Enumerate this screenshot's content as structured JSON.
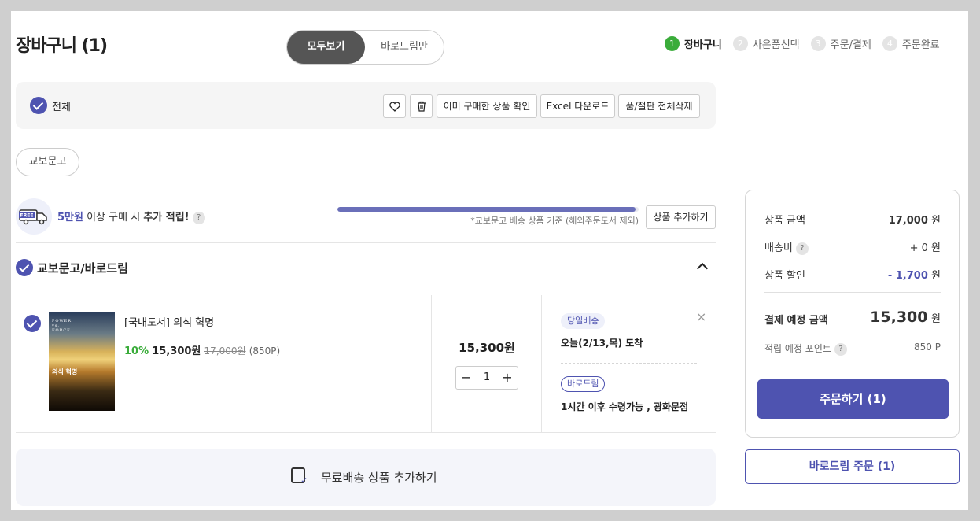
{
  "page": {
    "title": "장바구니 (1)"
  },
  "view_toggle": {
    "all": "모두보기",
    "barodrim_only": "바로드림만"
  },
  "steps": [
    {
      "num": "1",
      "label": "장바구니",
      "active": true
    },
    {
      "num": "2",
      "label": "사은품선택",
      "active": false
    },
    {
      "num": "3",
      "label": "주문/결제",
      "active": false
    },
    {
      "num": "4",
      "label": "주문완료",
      "active": false
    }
  ],
  "toolbar": {
    "select_all": "전체",
    "wish_icon": "heart-icon",
    "delete_icon": "trash-icon",
    "already_bought": "이미 구매한 상품 확인",
    "excel": "Excel 다운로드",
    "delete_soldout": "품/절판 전체삭제"
  },
  "filter_chip": "교보문고",
  "benefit": {
    "amount": "5만원",
    "text_mid": " 이상 구매 시 ",
    "text_bold": "추가 적립!",
    "help": "?",
    "note": "*교보문고 배송 상품 기준 (해외주문도서 제외)",
    "add_button": "상품 추가하기",
    "progress": 0.99,
    "truck_label": "FREE"
  },
  "group": {
    "name": "교보문고/바로드림"
  },
  "item": {
    "title": "[국내도서] 의식 혁명",
    "discount": "10%",
    "sale_price": "15,300원",
    "original_price": "17,000원",
    "points": "(850P)",
    "total": "15,300원",
    "qty": "1",
    "minus": "−",
    "plus": "+",
    "cover_en1": "POWER",
    "cover_en2": "vs.",
    "cover_en3": "FORCE",
    "cover_kr": "의식 혁명",
    "badge_today": "당일배송",
    "delivery_today": "오늘(2/13,목) 도착",
    "badge_baro": "바로드림",
    "delivery_baro": "1시간 이후 수령가능 , 광화문점",
    "remove": "×"
  },
  "free_shipping": {
    "label": "무료배송 상품 추가하기"
  },
  "summary": {
    "product_label": "상품 금액",
    "product_value": "17,000",
    "shipping_label": "배송비",
    "shipping_value": "+ 0",
    "discount_label": "상품 할인",
    "discount_value": "- 1,700",
    "total_label": "결제 예정 금액",
    "total_value": "15,300",
    "points_label": "적립 예정 포인트",
    "points_value": "850 P",
    "unit": "원",
    "order_button": "주문하기 (1)"
  },
  "barodrim_order": "바로드림 주문 (1)",
  "colors": {
    "accent": "#4e53b0",
    "green": "#3aac3a"
  }
}
